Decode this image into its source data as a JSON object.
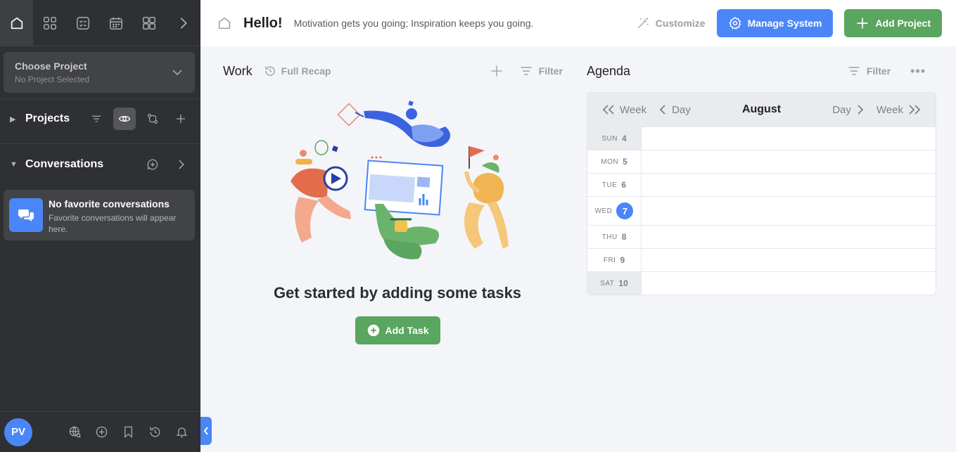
{
  "sidebar": {
    "project_select": {
      "title": "Choose Project",
      "subtitle": "No Project Selected"
    },
    "projects": {
      "label": "Projects"
    },
    "conversations": {
      "label": "Conversations"
    },
    "favorites": {
      "title": "No favorite conversations",
      "subtitle": "Favorite conversations will appear here."
    },
    "user": {
      "initials": "PV"
    },
    "nav_icons": [
      "home-icon",
      "grid-icon",
      "tasks-icon",
      "calendar-icon",
      "dashboard-icon",
      "chevron-right-icon"
    ],
    "bottom_icons": [
      "globe-search-icon",
      "add-circle-icon",
      "bookmark-icon",
      "history-icon",
      "bell-icon"
    ]
  },
  "header": {
    "greeting": "Hello!",
    "quote": "Motivation gets you going; Inspiration keeps you going.",
    "customize": "Customize",
    "manage_system": "Manage System",
    "add_project": "Add Project"
  },
  "work": {
    "title": "Work",
    "recap": "Full Recap",
    "filter": "Filter",
    "empty": "Get started by adding some tasks",
    "add_task": "Add Task"
  },
  "agenda": {
    "title": "Agenda",
    "filter": "Filter",
    "prev_week": "Week",
    "prev_day": "Day",
    "month": "August",
    "next_day": "Day",
    "next_week": "Week",
    "days": [
      {
        "name": "SUN",
        "num": "4"
      },
      {
        "name": "MON",
        "num": "5"
      },
      {
        "name": "TUE",
        "num": "6"
      },
      {
        "name": "WED",
        "num": "7"
      },
      {
        "name": "THU",
        "num": "8"
      },
      {
        "name": "FRI",
        "num": "9"
      },
      {
        "name": "SAT",
        "num": "10"
      }
    ]
  },
  "colors": {
    "accent": "#4a86f7",
    "success": "#5aa55f",
    "sidebar": "#2f3033"
  }
}
